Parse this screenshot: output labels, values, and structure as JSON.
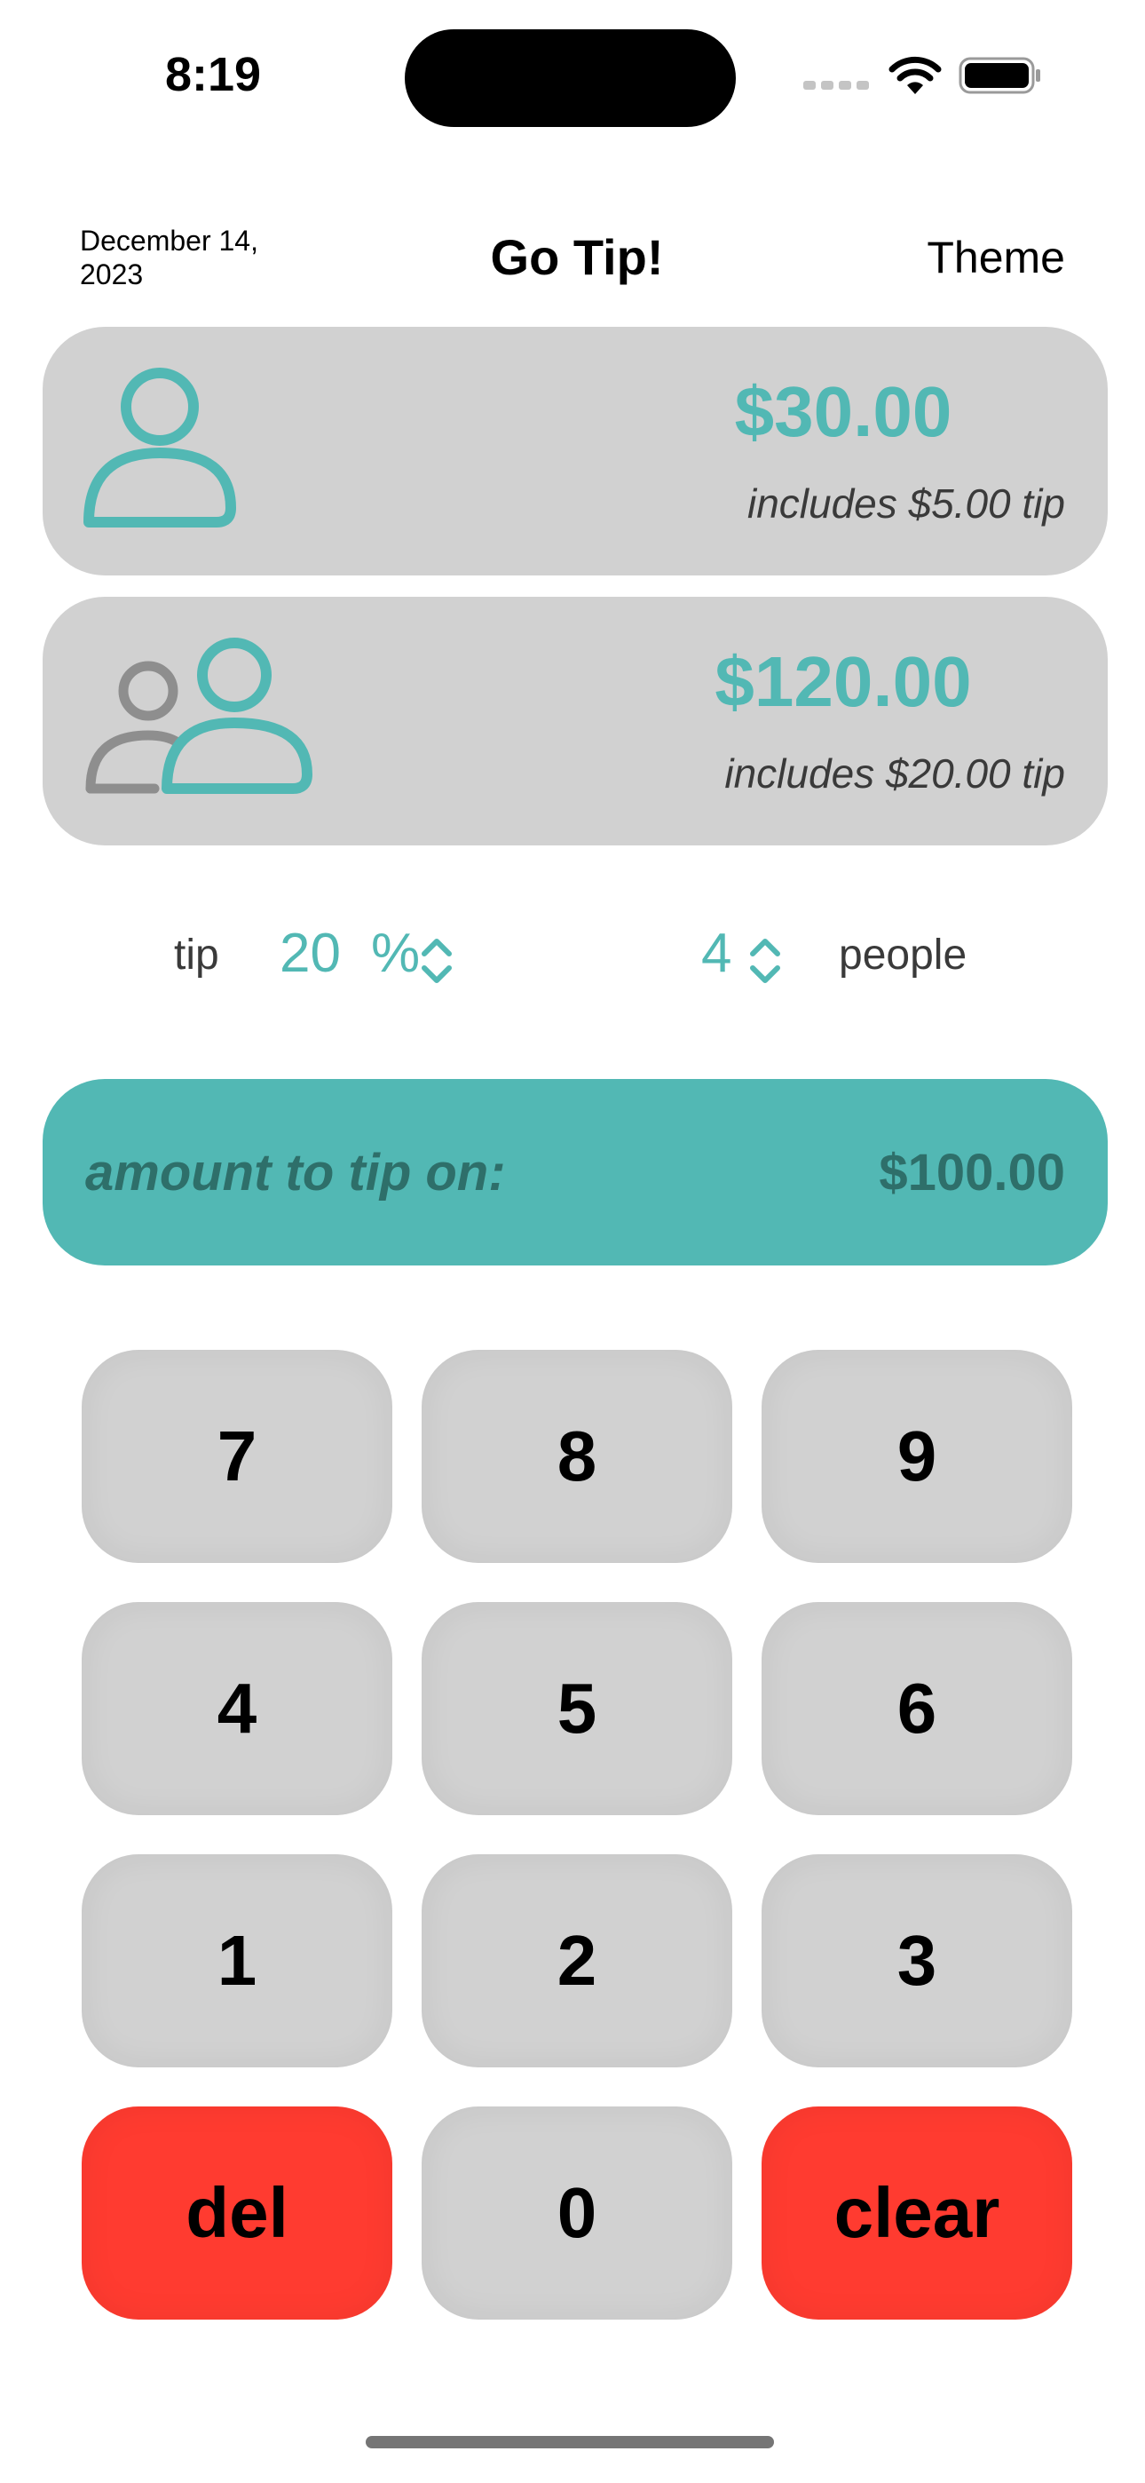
{
  "status_bar": {
    "time": "8:19"
  },
  "header": {
    "date": "December 14, 2023",
    "title": "Go Tip!",
    "theme_button": "Theme"
  },
  "cards": {
    "single": {
      "icon": "person-icon",
      "amount": "$30.00",
      "tip_note": "includes $5.00 tip"
    },
    "group": {
      "icon": "two-people-icon",
      "amount": "$120.00",
      "tip_note": "includes $20.00 tip"
    }
  },
  "controls": {
    "tip_label": "tip",
    "tip_value": "20",
    "tip_unit": "%",
    "people_value": "4",
    "people_label": "people"
  },
  "amount_bar": {
    "label": "amount to tip on:",
    "value": "$100.00"
  },
  "keypad": {
    "keys": [
      "7",
      "8",
      "9",
      "4",
      "5",
      "6",
      "1",
      "2",
      "3",
      "del",
      "0",
      "clear"
    ]
  },
  "colors": {
    "accent": "#52b8b4",
    "card": "#d1d1d1",
    "danger": "#ff3b30",
    "amount_text": "#2e6f6a"
  }
}
